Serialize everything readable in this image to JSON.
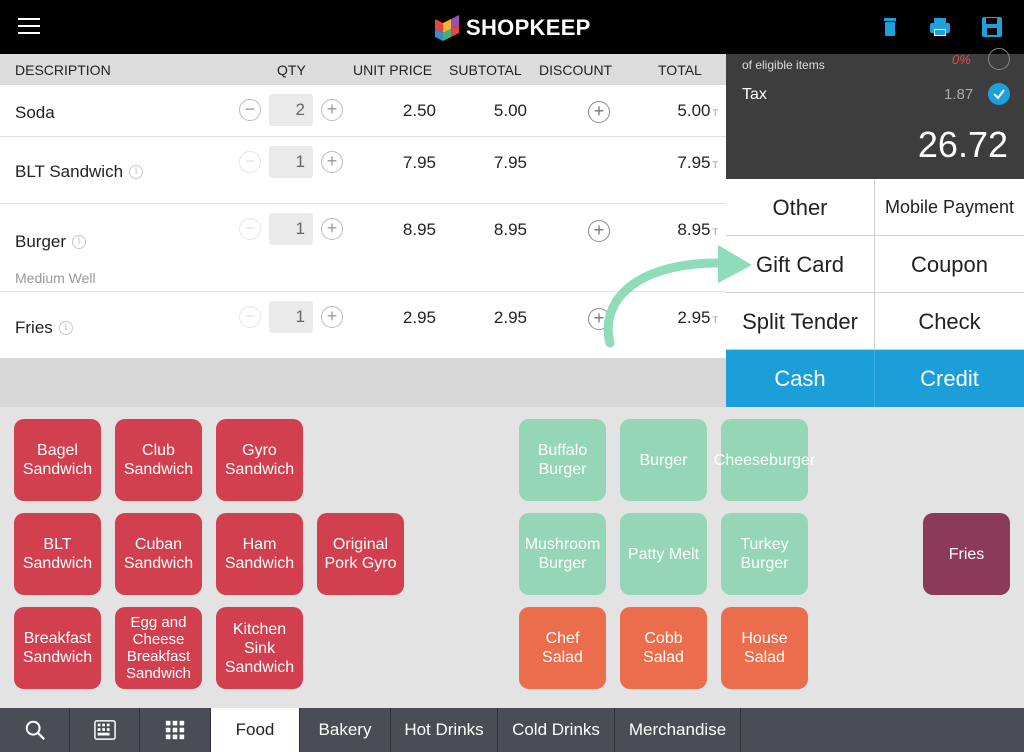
{
  "header": {
    "brand": "SHOPKEEP"
  },
  "columns": {
    "description": "DESCRIPTION",
    "qty": "QTY",
    "unit_price": "UNIT PRICE",
    "subtotal": "SUBTOTAL",
    "discount": "DISCOUNT",
    "total": "TOTAL"
  },
  "line_items": [
    {
      "name": "Soda",
      "qty": "2",
      "unit_price": "2.50",
      "subtotal": "5.00",
      "total": "5.00",
      "tax_flag": "T"
    },
    {
      "name": "BLT Sandwich",
      "qty": "1",
      "unit_price": "7.95",
      "subtotal": "7.95",
      "total": "7.95",
      "tax_flag": "T"
    },
    {
      "name": "Burger",
      "modifier": "Medium Well",
      "qty": "1",
      "unit_price": "8.95",
      "subtotal": "8.95",
      "total": "8.95",
      "tax_flag": "T"
    },
    {
      "name": "Fries",
      "qty": "1",
      "unit_price": "2.95",
      "subtotal": "2.95",
      "total": "2.95",
      "tax_flag": "T"
    }
  ],
  "totals": {
    "eligible_label": "of eligible items",
    "discount_pct": "0%",
    "tax_label": "Tax",
    "tax_value": "1.87",
    "grand_total": "26.72"
  },
  "tender": {
    "other": "Other",
    "mobile_payment": "Mobile Payment",
    "gift_card": "Gift Card",
    "coupon": "Coupon",
    "split_tender": "Split Tender",
    "check": "Check",
    "cash": "Cash",
    "credit": "Credit"
  },
  "items": {
    "bagel_sandwich": "Bagel Sandwich",
    "club_sandwich": "Club Sandwich",
    "gyro_sandwich": "Gyro Sandwich",
    "blt_sandwich": "BLT Sandwich",
    "cuban_sandwich": "Cuban Sandwich",
    "ham_sandwich": "Ham Sandwich",
    "original_pork_gyro": "Original Pork Gyro",
    "breakfast_sandwich": "Breakfast Sandwich",
    "egg_cheese_breakfast": "Egg and Cheese Breakfast Sandwich",
    "kitchen_sink_sandwich": "Kitchen Sink Sandwich",
    "buffalo_burger": "Buffalo Burger",
    "burger": "Burger",
    "cheeseburger": "Cheeseburger",
    "mushroom_burger": "Mushroom Burger",
    "patty_melt": "Patty Melt",
    "turkey_burger": "Turkey Burger",
    "chef_salad": "Chef Salad",
    "cobb_salad": "Cobb Salad",
    "house_salad": "House Salad",
    "fries": "Fries"
  },
  "tabs": {
    "food": "Food",
    "bakery": "Bakery",
    "hot_drinks": "Hot Drinks",
    "cold_drinks": "Cold Drinks",
    "merchandise": "Merchandise"
  },
  "colors": {
    "accent_blue": "#1c9fd8",
    "sandwich_red": "#d2404f",
    "burger_green": "#94d6b5",
    "salad_orange": "#ec6d4b",
    "side_plum": "#8b3a58",
    "arrow_mint": "#8fdcb8"
  }
}
